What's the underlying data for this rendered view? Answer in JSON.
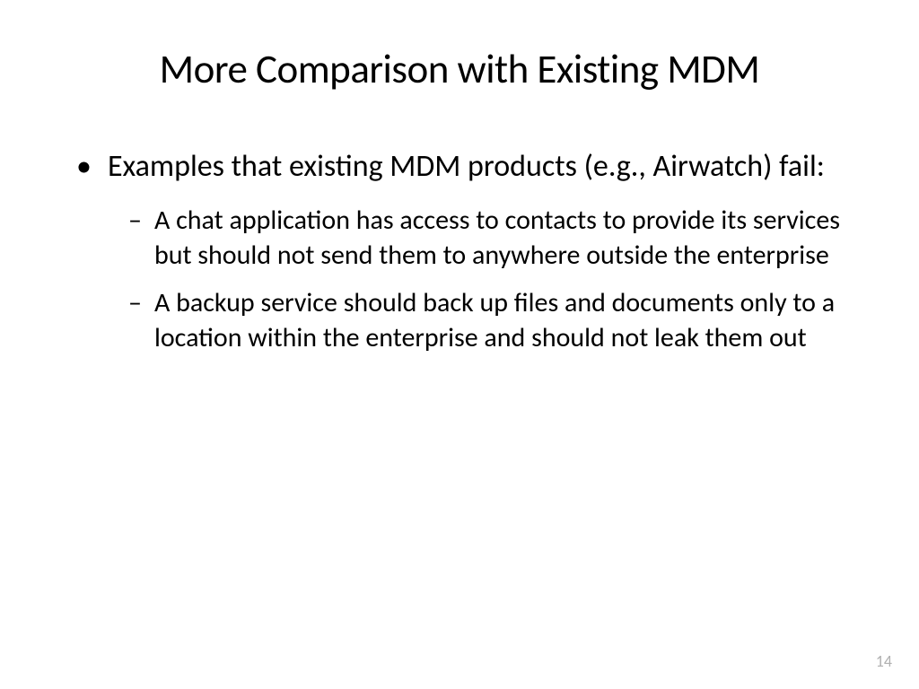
{
  "slide": {
    "title": "More Comparison with Existing MDM",
    "bullets": {
      "main": "Examples that existing MDM products (e.g., Airwatch) fail:",
      "sub1": "A chat application has access to contacts to provide its services but should not send them to anywhere outside the enterprise",
      "sub2": "A backup service should back up files and documents only to a location within the enterprise and should not leak them out"
    },
    "pageNumber": "14"
  }
}
